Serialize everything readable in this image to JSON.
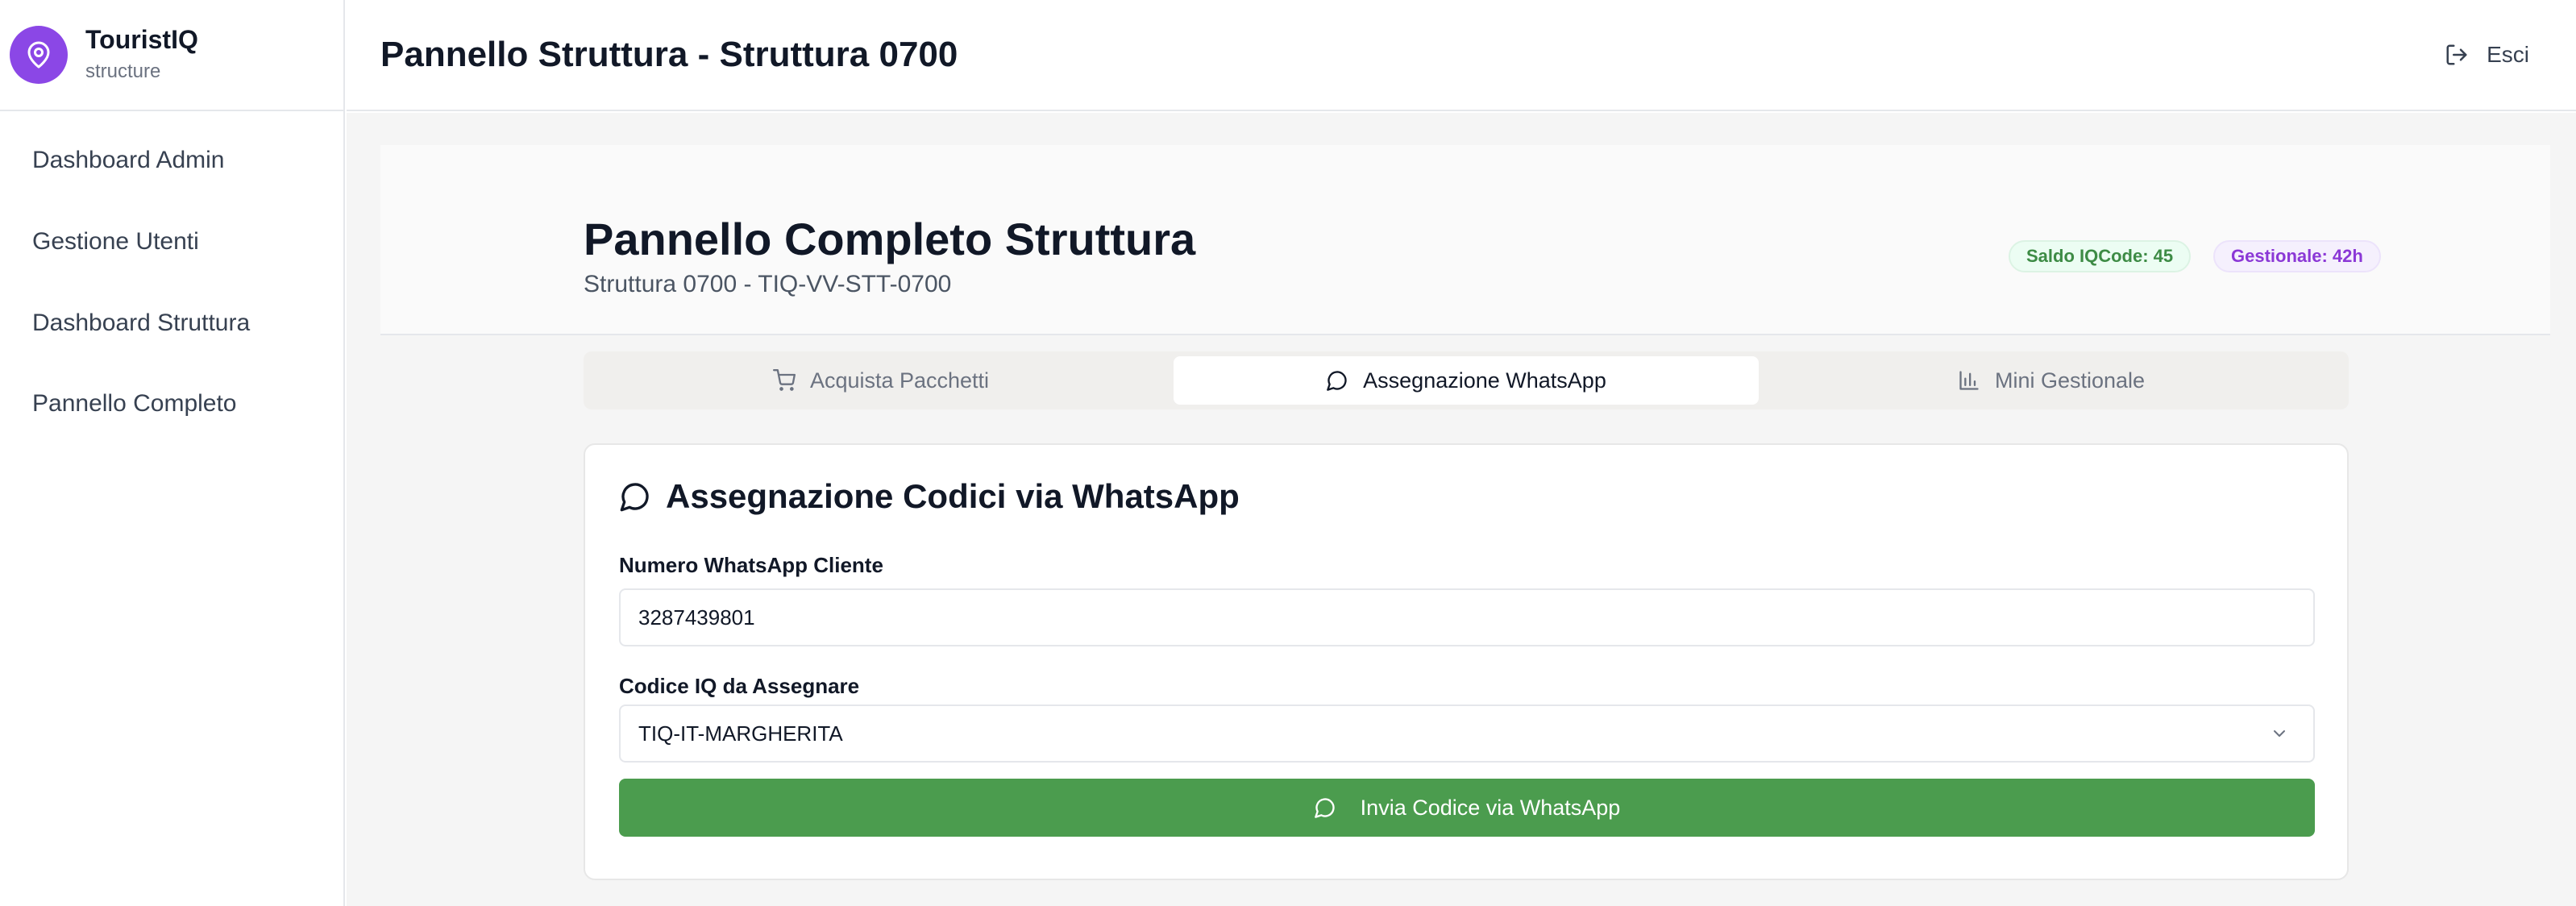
{
  "brand": {
    "name": "TouristIQ",
    "role": "structure",
    "logo_icon": "map-pin-icon",
    "color": "#8b47e6"
  },
  "sidebar": {
    "items": [
      {
        "label": "Dashboard Admin"
      },
      {
        "label": "Gestione Utenti"
      },
      {
        "label": "Dashboard Struttura"
      },
      {
        "label": "Pannello Completo"
      }
    ]
  },
  "header": {
    "title": "Pannello Struttura - Struttura 0700",
    "logout_label": "Esci",
    "logout_icon": "log-out-icon"
  },
  "hero": {
    "title": "Pannello Completo Struttura",
    "subtitle": "Struttura 0700 - TIQ-VV-STT-0700",
    "badges": {
      "saldo": "Saldo IQCode: 45",
      "gestionale": "Gestionale: 42h"
    }
  },
  "tabs": [
    {
      "label": "Acquista Pacchetti",
      "icon": "cart-icon",
      "active": false
    },
    {
      "label": "Assegnazione WhatsApp",
      "icon": "message-circle-icon",
      "active": true
    },
    {
      "label": "Mini Gestionale",
      "icon": "bar-chart-icon",
      "active": false
    }
  ],
  "card": {
    "title": "Assegnazione Codici via WhatsApp",
    "phone_label": "Numero WhatsApp Cliente",
    "phone_value": "3287439801",
    "code_label": "Codice IQ da Assegnare",
    "code_selected": "TIQ-IT-MARGHERITA",
    "send_label": "Invia Codice via WhatsApp"
  },
  "colors": {
    "accent_purple": "#8b47e6",
    "whatsapp_green": "#4b9c4e",
    "badge_green_text": "#3d8b45",
    "badge_purple_text": "#8b38d6"
  }
}
